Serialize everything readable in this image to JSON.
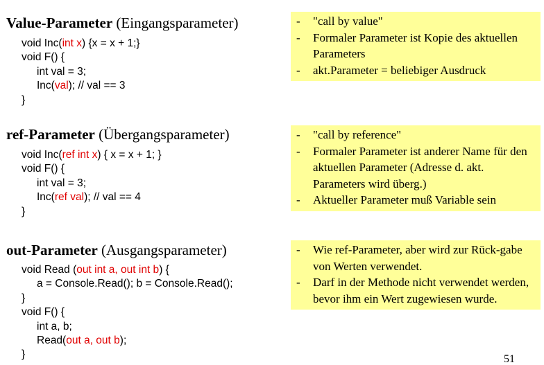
{
  "sections": [
    {
      "title_bold": "Value-Parameter",
      "title_rest": "(Eingangsparameter)",
      "code": [
        {
          "indent": 0,
          "parts": [
            {
              "t": "void Inc("
            },
            {
              "t": "int x",
              "hl": true
            },
            {
              "t": ") {x = x + 1;}"
            }
          ]
        },
        {
          "indent": 0,
          "parts": [
            {
              "t": "void F() {"
            }
          ]
        },
        {
          "indent": 1,
          "parts": [
            {
              "t": "int val = 3;"
            }
          ]
        },
        {
          "indent": 1,
          "parts": [
            {
              "t": "Inc("
            },
            {
              "t": "val",
              "hl": true
            },
            {
              "t": "); // val == 3"
            }
          ]
        },
        {
          "indent": 0,
          "parts": [
            {
              "t": "}"
            }
          ]
        }
      ],
      "notes": [
        "\"call by value\"",
        "Formaler Parameter ist Kopie des aktuellen Parameters",
        "akt.Parameter = beliebiger Ausdruck"
      ]
    },
    {
      "title_bold": "ref-Parameter",
      "title_rest": "(Übergangsparameter)",
      "code": [
        {
          "indent": 0,
          "parts": [
            {
              "t": "void Inc("
            },
            {
              "t": "ref int x",
              "hl": true
            },
            {
              "t": ") { x = x + 1; }"
            }
          ]
        },
        {
          "indent": 0,
          "parts": [
            {
              "t": "void F() {"
            }
          ]
        },
        {
          "indent": 1,
          "parts": [
            {
              "t": "int val = 3;"
            }
          ]
        },
        {
          "indent": 1,
          "parts": [
            {
              "t": "Inc("
            },
            {
              "t": "ref val",
              "hl": true
            },
            {
              "t": "); // val == 4"
            }
          ]
        },
        {
          "indent": 0,
          "parts": [
            {
              "t": "}"
            }
          ]
        }
      ],
      "notes": [
        "\"call by reference\"",
        "Formaler Parameter ist anderer Name für den aktuellen Parameter (Adresse d. akt. Parameters wird überg.)",
        "Aktueller Parameter muß Variable sein"
      ]
    },
    {
      "title_bold": "out-Parameter",
      "title_rest": "(Ausgangsparameter)",
      "code": [
        {
          "indent": 0,
          "parts": [
            {
              "t": "void Read ("
            },
            {
              "t": "out int a, out int b",
              "hl": true
            },
            {
              "t": ") {"
            }
          ]
        },
        {
          "indent": 1,
          "parts": [
            {
              "t": "a = Console.Read(); b = Console.Read();"
            }
          ]
        },
        {
          "indent": 0,
          "parts": [
            {
              "t": "}"
            }
          ]
        },
        {
          "indent": 0,
          "parts": [
            {
              "t": "void F() {"
            }
          ]
        },
        {
          "indent": 1,
          "parts": [
            {
              "t": "int a, b;"
            }
          ]
        },
        {
          "indent": 1,
          "parts": [
            {
              "t": "Read("
            },
            {
              "t": "out a, out b",
              "hl": true
            },
            {
              "t": ");"
            }
          ]
        },
        {
          "indent": 0,
          "parts": [
            {
              "t": "}"
            }
          ]
        }
      ],
      "notes": [
        "Wie ref-Parameter, aber wird zur Rück-gabe von Werten verwendet.",
        "Darf in der Methode nicht verwendet werden, bevor ihm ein Wert zugewiesen wurde."
      ]
    }
  ],
  "page_number": "51",
  "colors": {
    "highlight": "#e00000",
    "note_background": "#ffff99"
  }
}
